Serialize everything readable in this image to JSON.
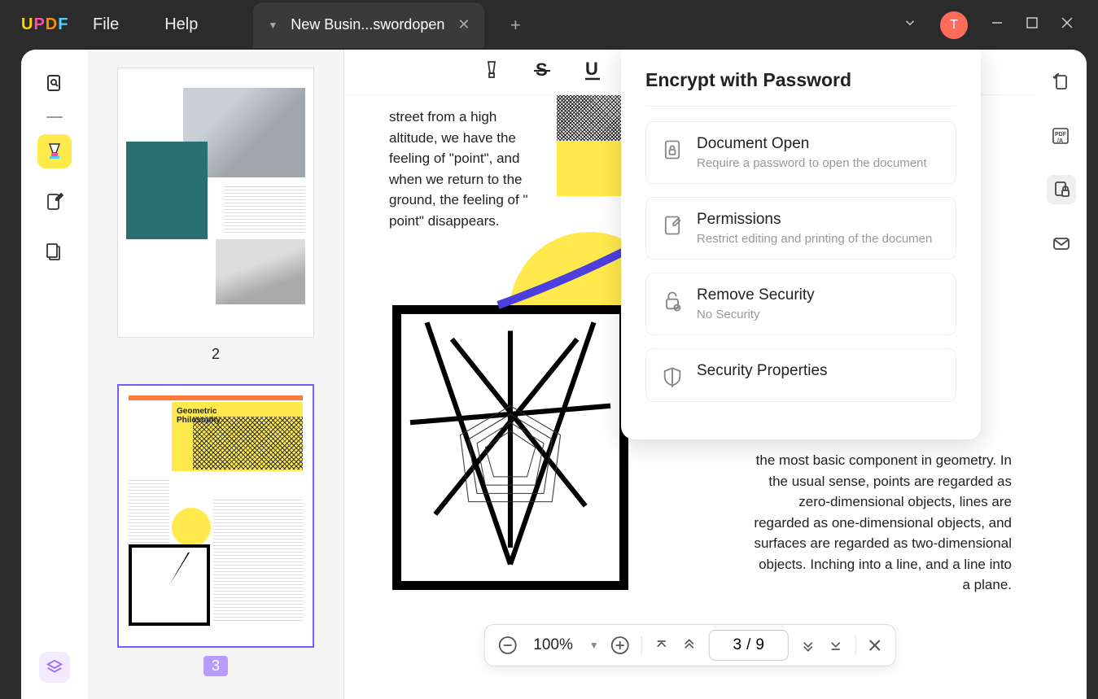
{
  "menu": {
    "file": "File",
    "help": "Help"
  },
  "tab": {
    "title": "New Busin...swordopen"
  },
  "avatar": "T",
  "thumbs": {
    "p2": "2",
    "p3": "3",
    "geo_title": "Geometric",
    "geo_sub": "Philosophy"
  },
  "page_text_1": "street from a high altitude, we have the feeling of \"point\", and when we return to the ground, the feeling of \" point\" disappears.",
  "page_text_2": "the most basic component in geometry. In the usual sense, points are regarded as zero-dimensional objects, lines are regarded as one-dimensional objects, and surfaces are regarded as two-dimensional objects. Inching into a line, and a line into a plane.",
  "panel": {
    "title": "Encrypt with Password",
    "doc_open": {
      "t": "Document Open",
      "d": "Require a password to open the document"
    },
    "perm": {
      "t": "Permissions",
      "d": "Restrict editing and printing of the documen"
    },
    "remove": {
      "t": "Remove Security",
      "d": "No Security"
    },
    "props": {
      "t": "Security Properties"
    }
  },
  "zoom": {
    "value": "100%",
    "page": "3",
    "sep": "/",
    "total": "9"
  }
}
